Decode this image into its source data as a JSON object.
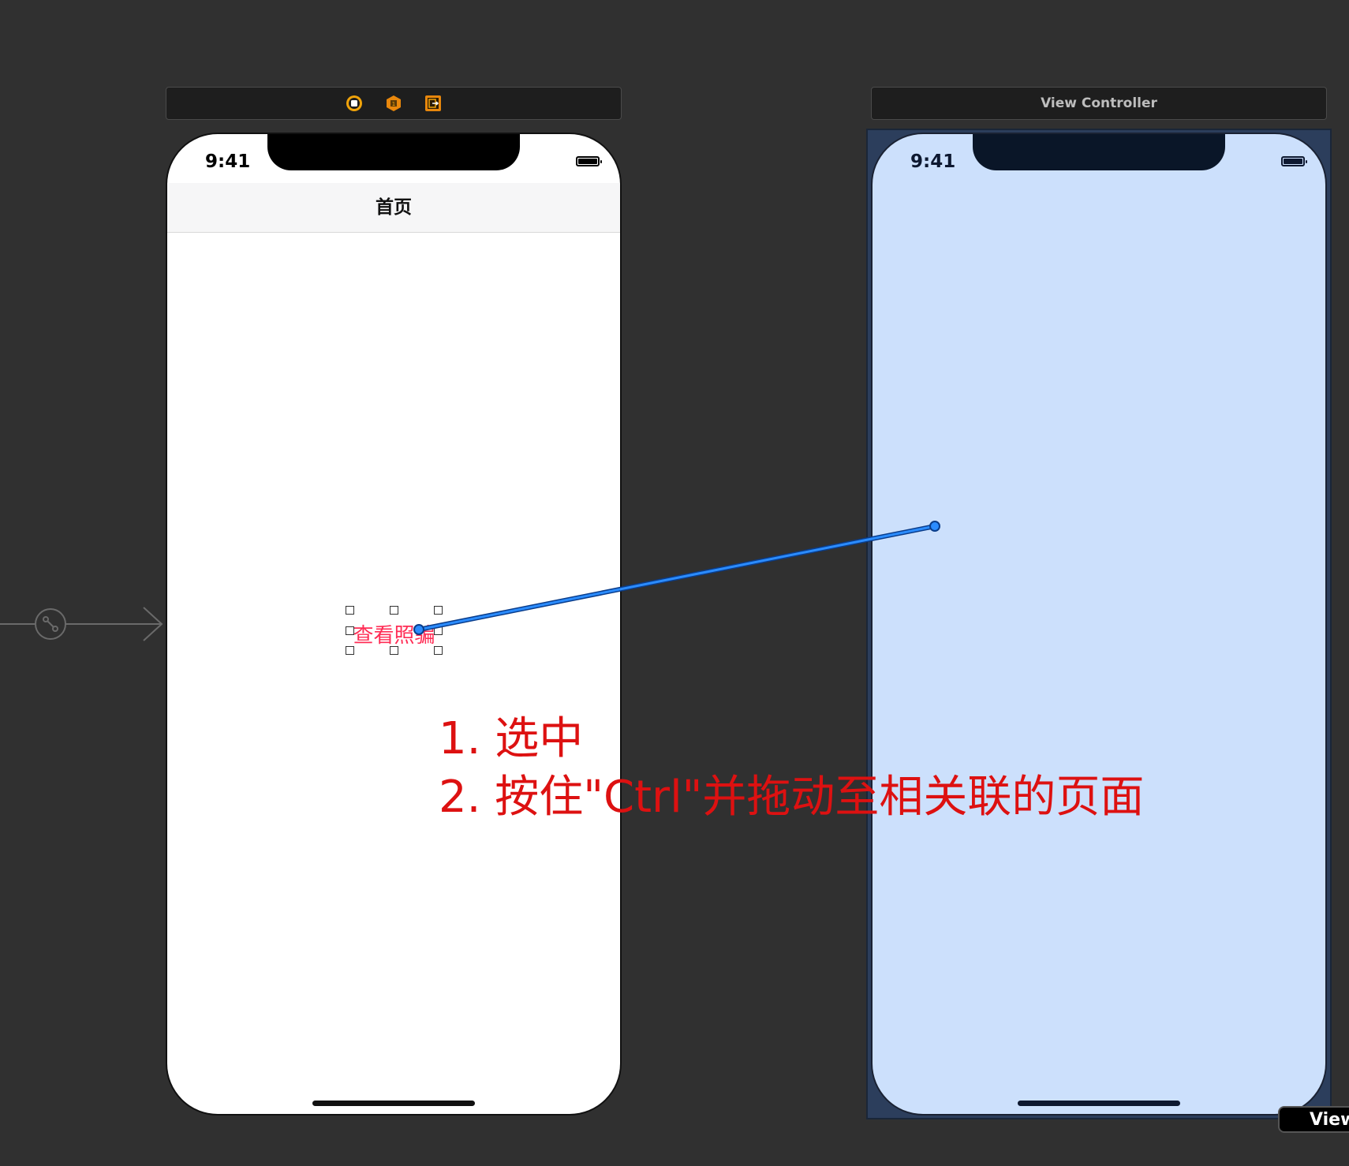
{
  "scene_left": {
    "dock_icons": [
      "view-controller-icon",
      "first-responder-icon",
      "exit-icon"
    ],
    "status_time": "9:41",
    "nav_title": "首页",
    "button_label": "查看照骗"
  },
  "scene_right": {
    "dock_title": "View Controller",
    "status_time": "9:41",
    "corner_tag": "View"
  },
  "annotation": {
    "line1": "1. 选中",
    "line2": "2. 按住\"Ctrl\"并拖动至相关联的页面"
  },
  "colors": {
    "canvas": "#303030",
    "button_text": "#ff2d55",
    "annotation_text": "#dd1111",
    "connection_line": "#1a7bff",
    "selected_view_bg": "#cce0fc"
  }
}
